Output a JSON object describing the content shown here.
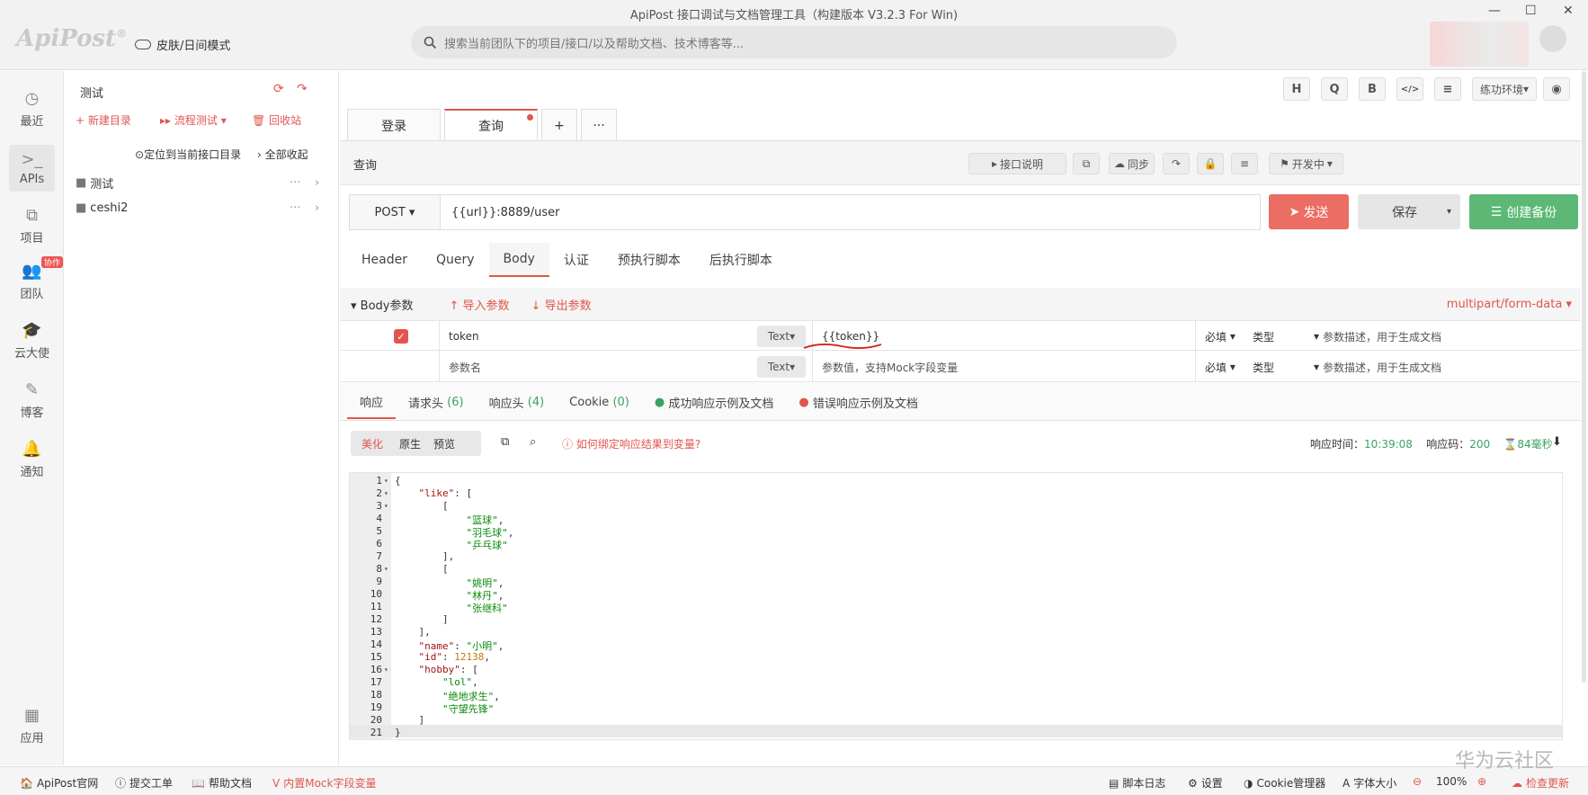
{
  "window": {
    "title": "ApiPost 接口调试与文档管理工具（构建版本 V3.2.3 For Win)",
    "logo": "ApiPost",
    "skin_mode": "皮肤/日间模式"
  },
  "search": {
    "placeholder": "搜索当前团队下的项目/接口/以及帮助文档、技术博客等..."
  },
  "nav": [
    {
      "label": "最近",
      "icon": "clock-icon"
    },
    {
      "label": "APIs",
      "icon": "terminal-icon"
    },
    {
      "label": "项目",
      "icon": "project-icon"
    },
    {
      "label": "团队",
      "icon": "team-icon",
      "badge": "协作"
    },
    {
      "label": "云大使",
      "icon": "graduation-icon"
    },
    {
      "label": "博客",
      "icon": "edit-icon"
    },
    {
      "label": "通知",
      "icon": "bell-icon"
    },
    {
      "label": "应用",
      "icon": "apps-icon"
    }
  ],
  "tree": {
    "title": "测试",
    "new_dir": "新建目录",
    "flow_test": "流程测试",
    "recycle": "回收站",
    "locate": "定位到当前接口目录",
    "collapse": "全部收起",
    "items": [
      "测试",
      "ceshi2"
    ]
  },
  "toolbar": {
    "h": "H",
    "q": "Q",
    "b": "B",
    "code": "</>",
    "settings": "≡",
    "env": "练功环境",
    "eye": "◉"
  },
  "tabs": [
    {
      "label": "登录"
    },
    {
      "label": "查询",
      "active": true
    }
  ],
  "tab_add": "+",
  "tab_more": "···",
  "api": {
    "name": "查询",
    "doc_btn": "接口说明",
    "sync_btn": "同步",
    "status": "开发中",
    "method": "POST",
    "url": "{{url}}:8889/user"
  },
  "actions": {
    "send": "发送",
    "save": "保存",
    "create_backup": "创建备份"
  },
  "req_tabs": [
    "Header",
    "Query",
    "Body",
    "认证",
    "预执行脚本",
    "后执行脚本"
  ],
  "body": {
    "label": "Body参数",
    "import": "导入参数",
    "export": "导出参数",
    "content_type": "multipart/form-data",
    "rows": [
      {
        "key": "token",
        "type": "Text",
        "value": "{{token}}",
        "required": "必填",
        "ptype": "类型",
        "desc": "参数描述，用于生成文档",
        "checked": true
      },
      {
        "key": "参数名",
        "type": "Text",
        "value": "参数值，支持Mock字段变量",
        "required": "必填",
        "ptype": "类型",
        "desc": "参数描述，用于生成文档",
        "checked": false
      }
    ]
  },
  "resp_tabs": [
    {
      "label": "响应"
    },
    {
      "label": "请求头",
      "count": "(6)"
    },
    {
      "label": "响应头",
      "count": "(4)"
    },
    {
      "label": "Cookie",
      "count": "(0)"
    },
    {
      "label": "成功响应示例及文档"
    },
    {
      "label": "错误响应示例及文档"
    }
  ],
  "view": {
    "modes": [
      "美化",
      "原生",
      "预览"
    ],
    "bind_hint": "如何绑定响应结果到变量?"
  },
  "resp_meta": {
    "time_label": "响应时间：",
    "time": "10:39:08",
    "code_label": "响应码：",
    "code": "200",
    "duration": "84毫秒"
  },
  "code_lines": [
    {
      "n": "1",
      "t": "{",
      "fold": true
    },
    {
      "n": "2",
      "t": "    \"like\": [",
      "fold": true
    },
    {
      "n": "3",
      "t": "        [",
      "fold": true
    },
    {
      "n": "4",
      "t": "            \"篮球\","
    },
    {
      "n": "5",
      "t": "            \"羽毛球\","
    },
    {
      "n": "6",
      "t": "            \"乒乓球\""
    },
    {
      "n": "7",
      "t": "        ],"
    },
    {
      "n": "8",
      "t": "        [",
      "fold": true
    },
    {
      "n": "9",
      "t": "            \"姚明\","
    },
    {
      "n": "10",
      "t": "            \"林丹\","
    },
    {
      "n": "11",
      "t": "            \"张继科\""
    },
    {
      "n": "12",
      "t": "        ]"
    },
    {
      "n": "13",
      "t": "    ],"
    },
    {
      "n": "14",
      "t": "    \"name\": \"小明\","
    },
    {
      "n": "15",
      "t": "    \"id\": 12138,"
    },
    {
      "n": "16",
      "t": "    \"hobby\": [",
      "fold": true
    },
    {
      "n": "17",
      "t": "        \"lol\","
    },
    {
      "n": "18",
      "t": "        \"绝地求生\","
    },
    {
      "n": "19",
      "t": "        \"守望先锋\""
    },
    {
      "n": "20",
      "t": "    ]"
    },
    {
      "n": "21",
      "t": "}"
    }
  ],
  "statusbar": {
    "official": "ApiPost官网",
    "ticket": "提交工单",
    "help": "帮助文档",
    "mock": "内置Mock字段变量",
    "script_log": "脚本日志",
    "settings": "设置",
    "cookie": "Cookie管理器",
    "font_size": "字体大小",
    "zoom": "100%",
    "check_update": "检查更新"
  },
  "watermark": "华为云社区"
}
